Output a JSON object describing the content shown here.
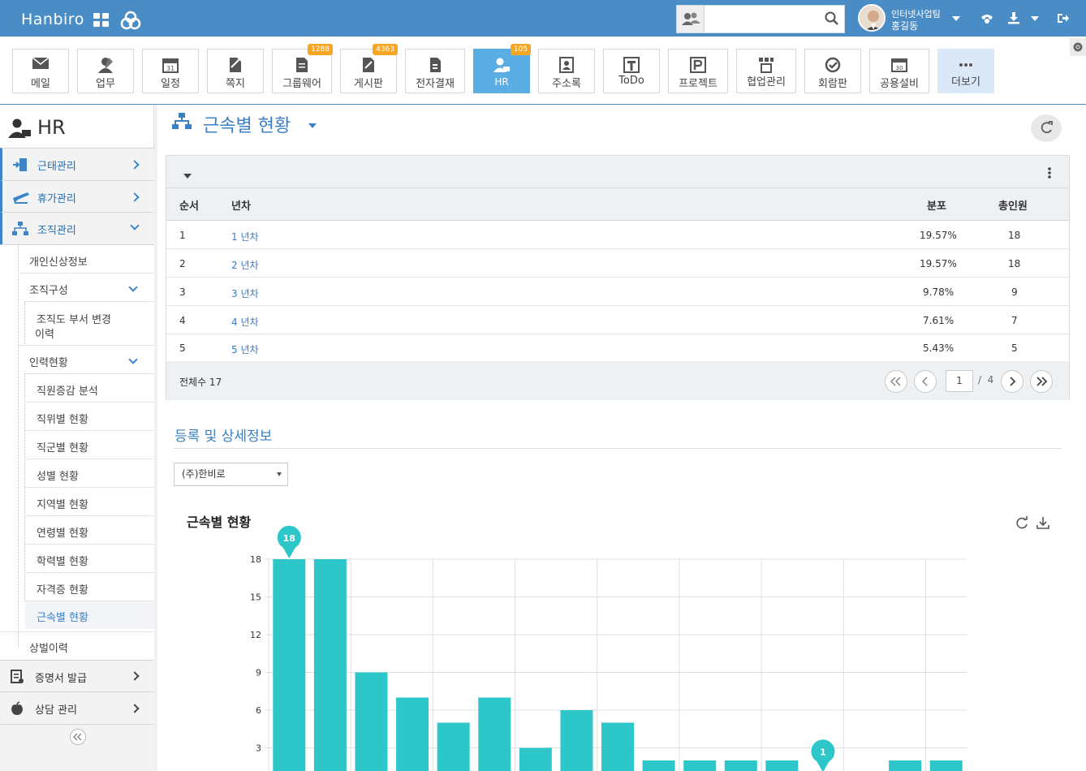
{
  "topbar": {
    "brand": "Hanbiro",
    "search": {
      "value": "",
      "placeholder": ""
    },
    "user": {
      "dept": "인터넷사업팀",
      "name": "홍길동"
    }
  },
  "apps": [
    {
      "label": "메일",
      "icon": "mail-icon"
    },
    {
      "label": "업무",
      "icon": "task-icon"
    },
    {
      "label": "일정",
      "icon": "calendar-icon"
    },
    {
      "label": "쪽지",
      "icon": "note-icon"
    },
    {
      "label": "그룹웨어",
      "icon": "groupware-icon",
      "badge": "1288"
    },
    {
      "label": "게시판",
      "icon": "board-icon",
      "badge": "4363"
    },
    {
      "label": "전자결재",
      "icon": "approval-icon"
    },
    {
      "label": "HR",
      "icon": "hr-icon",
      "badge": "105",
      "active": true
    },
    {
      "label": "주소록",
      "icon": "contacts-icon"
    },
    {
      "label": "ToDo",
      "icon": "todo-icon"
    },
    {
      "label": "프로젝트",
      "icon": "project-icon"
    },
    {
      "label": "협업관리",
      "icon": "collab-icon"
    },
    {
      "label": "회람판",
      "icon": "circular-icon"
    },
    {
      "label": "공용설비",
      "icon": "facility-icon"
    },
    {
      "label": "더보기",
      "icon": "more-icon"
    }
  ],
  "sidebar": {
    "title": "HR",
    "menus": [
      {
        "label": "근태관리"
      },
      {
        "label": "휴가관리"
      },
      {
        "label": "조직관리"
      },
      {
        "label": "증명서 발급"
      },
      {
        "label": "상담 관리"
      }
    ],
    "org": {
      "personal": "개인신상정보",
      "structure": "조직구성",
      "dept_history_1": "조직도 부서 변경",
      "dept_history_2": "이력",
      "staffing": "인력현황",
      "staffing_items": [
        "직원증감 분석",
        "직위별 현황",
        "직군별 현황",
        "성별 현황",
        "지역별 현황",
        "연령별 현황",
        "학력별 현황",
        "자격증 현황",
        "근속별 현황"
      ],
      "awards": "상벌이력"
    }
  },
  "page": {
    "title": "근속별 현황",
    "table": {
      "headers": {
        "order": "순서",
        "years": "년차",
        "dist": "분포",
        "total": "총인원"
      },
      "rows": [
        {
          "order": "1",
          "years": "1 년차",
          "dist": "19.57%",
          "total": "18"
        },
        {
          "order": "2",
          "years": "2 년차",
          "dist": "19.57%",
          "total": "18"
        },
        {
          "order": "3",
          "years": "3 년차",
          "dist": "9.78%",
          "total": "9"
        },
        {
          "order": "4",
          "years": "4 년차",
          "dist": "7.61%",
          "total": "7"
        },
        {
          "order": "5",
          "years": "5 년차",
          "dist": "5.43%",
          "total": "5"
        }
      ],
      "total_label": "전체수 17",
      "page_current": "1",
      "page_total": "4"
    },
    "section_title": "등록 및 상세정보",
    "company_select": "(주)한비로",
    "chart_title": "근속별 현황"
  },
  "chart_data": {
    "type": "bar",
    "title": "근속별 현황",
    "values": [
      18,
      18,
      9,
      7,
      5,
      7,
      3,
      6,
      5,
      2,
      2,
      2,
      2,
      1,
      0,
      2,
      2
    ],
    "yticks": [
      "18",
      "15",
      "12",
      "9",
      "6",
      "3"
    ],
    "ylim": [
      0,
      18
    ],
    "markers": [
      {
        "index": 0,
        "label": "18"
      },
      {
        "index": 13,
        "label": "1"
      }
    ],
    "color": "#2ec7c9",
    "grid": true
  },
  "colors": {
    "topbar": "#4a8cc5",
    "accent": "#3b7fc4",
    "bar": "#2ec7c9",
    "badge": "#f5a623"
  }
}
